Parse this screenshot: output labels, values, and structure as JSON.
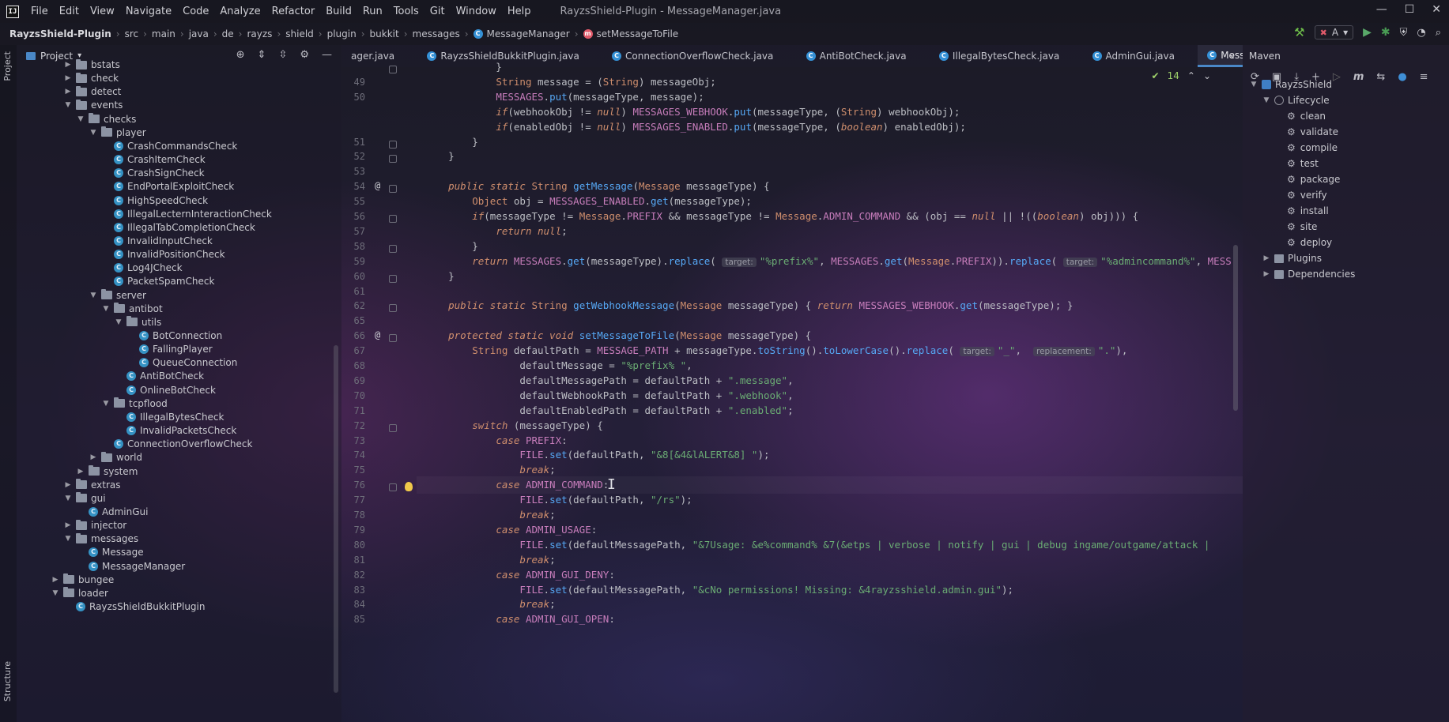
{
  "window": {
    "title": "RayzsShield-Plugin - MessageManager.java",
    "logo": "IJ"
  },
  "menu": [
    "File",
    "Edit",
    "View",
    "Navigate",
    "Code",
    "Analyze",
    "Refactor",
    "Build",
    "Run",
    "Tools",
    "Git",
    "Window",
    "Help"
  ],
  "breadcrumb": {
    "project": "RayzsShield-Plugin",
    "parts": [
      "src",
      "main",
      "java",
      "de",
      "rayzs",
      "shield",
      "plugin",
      "bukkit",
      "messages"
    ],
    "class": "MessageManager",
    "method": "setMessageToFile"
  },
  "toolbar": {
    "user": "A"
  },
  "left_stripe": {
    "project": "Project",
    "structure": "Structure"
  },
  "project_panel": {
    "title": "Project",
    "tree": [
      {
        "label": "bstats",
        "type": "folder",
        "depth": 4,
        "state": "collapsed"
      },
      {
        "label": "check",
        "type": "folder",
        "depth": 4,
        "state": "collapsed"
      },
      {
        "label": "detect",
        "type": "folder",
        "depth": 4,
        "state": "collapsed"
      },
      {
        "label": "events",
        "type": "folder",
        "depth": 4,
        "state": "expanded"
      },
      {
        "label": "checks",
        "type": "folder",
        "depth": 5,
        "state": "expanded"
      },
      {
        "label": "player",
        "type": "folder",
        "depth": 6,
        "state": "expanded"
      },
      {
        "label": "CrashCommandsCheck",
        "type": "class",
        "depth": 7
      },
      {
        "label": "CrashItemCheck",
        "type": "class",
        "depth": 7
      },
      {
        "label": "CrashSignCheck",
        "type": "class",
        "depth": 7
      },
      {
        "label": "EndPortalExploitCheck",
        "type": "class",
        "depth": 7
      },
      {
        "label": "HighSpeedCheck",
        "type": "class",
        "depth": 7
      },
      {
        "label": "IllegalLecternInteractionCheck",
        "type": "class",
        "depth": 7
      },
      {
        "label": "IllegalTabCompletionCheck",
        "type": "class",
        "depth": 7
      },
      {
        "label": "InvalidInputCheck",
        "type": "class",
        "depth": 7
      },
      {
        "label": "InvalidPositionCheck",
        "type": "class",
        "depth": 7
      },
      {
        "label": "Log4JCheck",
        "type": "class",
        "depth": 7
      },
      {
        "label": "PacketSpamCheck",
        "type": "class",
        "depth": 7
      },
      {
        "label": "server",
        "type": "folder",
        "depth": 6,
        "state": "expanded"
      },
      {
        "label": "antibot",
        "type": "folder",
        "depth": 7,
        "state": "expanded"
      },
      {
        "label": "utils",
        "type": "folder",
        "depth": 8,
        "state": "expanded"
      },
      {
        "label": "BotConnection",
        "type": "class",
        "depth": 9
      },
      {
        "label": "FallingPlayer",
        "type": "class",
        "depth": 9
      },
      {
        "label": "QueueConnection",
        "type": "class",
        "depth": 9
      },
      {
        "label": "AntiBotCheck",
        "type": "class",
        "depth": 8
      },
      {
        "label": "OnlineBotCheck",
        "type": "class",
        "depth": 8
      },
      {
        "label": "tcpflood",
        "type": "folder",
        "depth": 7,
        "state": "expanded"
      },
      {
        "label": "IllegalBytesCheck",
        "type": "class",
        "depth": 8
      },
      {
        "label": "InvalidPacketsCheck",
        "type": "class",
        "depth": 8
      },
      {
        "label": "ConnectionOverflowCheck",
        "type": "class",
        "depth": 7
      },
      {
        "label": "world",
        "type": "folder",
        "depth": 6,
        "state": "collapsed"
      },
      {
        "label": "system",
        "type": "folder",
        "depth": 5,
        "state": "collapsed"
      },
      {
        "label": "extras",
        "type": "folder",
        "depth": 4,
        "state": "collapsed"
      },
      {
        "label": "gui",
        "type": "folder",
        "depth": 4,
        "state": "expanded"
      },
      {
        "label": "AdminGui",
        "type": "class",
        "depth": 5
      },
      {
        "label": "injector",
        "type": "folder",
        "depth": 4,
        "state": "collapsed"
      },
      {
        "label": "messages",
        "type": "folder",
        "depth": 4,
        "state": "expanded"
      },
      {
        "label": "Message",
        "type": "class",
        "depth": 5
      },
      {
        "label": "MessageManager",
        "type": "class",
        "depth": 5
      },
      {
        "label": "bungee",
        "type": "folder",
        "depth": 3,
        "state": "collapsed"
      },
      {
        "label": "loader",
        "type": "folder",
        "depth": 3,
        "state": "expanded"
      },
      {
        "label": "RayzsShieldBukkitPlugin",
        "type": "class",
        "depth": 4
      }
    ]
  },
  "tabs": [
    {
      "label": "ager.java",
      "active": false
    },
    {
      "label": "RayzsShieldBukkitPlugin.java",
      "active": false
    },
    {
      "label": "ConnectionOverflowCheck.java",
      "active": false
    },
    {
      "label": "AntiBotCheck.java",
      "active": false
    },
    {
      "label": "IllegalBytesCheck.java",
      "active": false
    },
    {
      "label": "AdminGui.java",
      "active": false
    },
    {
      "label": "MessageManager.java",
      "active": true
    }
  ],
  "editor": {
    "inspection_count": "14",
    "lines": [
      {
        "n": "",
        "html": "            }"
      },
      {
        "n": "49",
        "html": "            <span class=\"kw\">String</span> message = (<span class=\"kw\">String</span>) messageObj;"
      },
      {
        "n": "50",
        "html": "            <span class=\"cn2\">MESSAGES</span>.<span class=\"fn\">put</span>(messageType, message);"
      },
      {
        "n": "",
        "html": "            <span class=\"it\">if</span>(webhookObj != <span class=\"it\">null</span>) <span class=\"cn2\">MESSAGES_WEBHOOK</span>.<span class=\"fn\">put</span>(messageType, (<span class=\"kw\">String</span>) webhookObj);"
      },
      {
        "n": "",
        "html": "            <span class=\"it\">if</span>(enabledObj != <span class=\"it\">null</span>) <span class=\"cn2\">MESSAGES_ENABLED</span>.<span class=\"fn\">put</span>(messageType, (<span class=\"it\">boolean</span>) enabledObj);"
      },
      {
        "n": "51",
        "html": "        }"
      },
      {
        "n": "52",
        "html": "    }"
      },
      {
        "n": "53",
        "html": ""
      },
      {
        "n": "54",
        "html": "    <span class=\"it\">public static</span> <span class=\"kw\">String</span> <span class=\"fn\">getMessage</span>(<span class=\"kw\">Message</span> messageType) {"
      },
      {
        "n": "55",
        "html": "        <span class=\"kw\">Object</span> obj = <span class=\"cn2\">MESSAGES_ENABLED</span>.<span class=\"fn\">get</span>(messageType);"
      },
      {
        "n": "56",
        "html": "        <span class=\"it\">if</span>(messageType != <span class=\"kw\">Message</span>.<span class=\"cn2\">PREFIX</span> &amp;&amp; messageType != <span class=\"kw\">Message</span>.<span class=\"cn2\">ADMIN_COMMAND</span> &amp;&amp; (obj == <span class=\"it\">null</span> || !((<span class=\"it\">boolean</span>) obj))) {"
      },
      {
        "n": "57",
        "html": "            <span class=\"it\">return null</span>;"
      },
      {
        "n": "58",
        "html": "        }"
      },
      {
        "n": "59",
        "html": "        <span class=\"it\">return</span> <span class=\"cn2\">MESSAGES</span>.<span class=\"fn\">get</span>(messageType).<span class=\"fn\">replace</span>( <span class=\"hint\">target:</span><span class=\"st\">\"%prefix%\"</span>, <span class=\"cn2\">MESSAGES</span>.<span class=\"fn\">get</span>(<span class=\"kw\">Message</span>.<span class=\"cn2\">PREFIX</span>)).<span class=\"fn\">replace</span>( <span class=\"hint\">target:</span><span class=\"st\">\"%admincommand%\"</span>, <span class=\"cn2\">MESS</span>"
      },
      {
        "n": "60",
        "html": "    }"
      },
      {
        "n": "61",
        "html": ""
      },
      {
        "n": "62",
        "html": "    <span class=\"it\">public static</span> <span class=\"kw\">String</span> <span class=\"fn\">getWebhookMessage</span>(<span class=\"kw\">Message</span> messageType) { <span class=\"it\">return</span> <span class=\"cn2\">MESSAGES_WEBHOOK</span>.<span class=\"fn\">get</span>(messageType); }"
      },
      {
        "n": "65",
        "html": ""
      },
      {
        "n": "66",
        "html": "    <span class=\"it\">protected static void</span> <span class=\"fn\">setMessageToFile</span>(<span class=\"kw\">Message</span> messageType) {"
      },
      {
        "n": "67",
        "html": "        <span class=\"kw\">String</span> defaultPath = <span class=\"cn2\">MESSAGE_PATH</span> + messageType.<span class=\"fn\">toString</span>().<span class=\"fn\">toLowerCase</span>().<span class=\"fn\">replace</span>( <span class=\"hint\">target:</span><span class=\"st\">\"_\"</span>,  <span class=\"hint\">replacement:</span><span class=\"st\">\".\"</span>),"
      },
      {
        "n": "68",
        "html": "                defaultMessage = <span class=\"st\">\"%prefix% \"</span>,"
      },
      {
        "n": "69",
        "html": "                defaultMessagePath = defaultPath + <span class=\"st\">\".message\"</span>,"
      },
      {
        "n": "70",
        "html": "                defaultWebhookPath = defaultPath + <span class=\"st\">\".webhook\"</span>,"
      },
      {
        "n": "71",
        "html": "                defaultEnabledPath = defaultPath + <span class=\"st\">\".enabled\"</span>;"
      },
      {
        "n": "72",
        "html": "        <span class=\"it\">switch</span> (messageType) {"
      },
      {
        "n": "73",
        "html": "            <span class=\"it\">case</span> <span class=\"cn2\">PREFIX</span>:"
      },
      {
        "n": "74",
        "html": "                <span class=\"cn2\">FILE</span>.<span class=\"fn\">set</span>(defaultPath, <span class=\"st\">\"&amp;8[&amp;4&amp;lALERT&amp;8] \"</span>);"
      },
      {
        "n": "75",
        "html": "                <span class=\"it\">break</span>;"
      },
      {
        "n": "76",
        "html": "            <span class=\"it\">case</span> <span class=\"cn2\">ADMIN_COMMAND</span>:"
      },
      {
        "n": "77",
        "html": "                <span class=\"cn2\">FILE</span>.<span class=\"fn\">set</span>(defaultPath, <span class=\"st\">\"/rs\"</span>);"
      },
      {
        "n": "78",
        "html": "                <span class=\"it\">break</span>;"
      },
      {
        "n": "79",
        "html": "            <span class=\"it\">case</span> <span class=\"cn2\">ADMIN_USAGE</span>:"
      },
      {
        "n": "80",
        "html": "                <span class=\"cn2\">FILE</span>.<span class=\"fn\">set</span>(defaultMessagePath, <span class=\"st\">\"&amp;7Usage: &amp;e%command% &amp;7(&amp;etps | verbose | notify | gui | debug ingame/outgame/attack |</span>"
      },
      {
        "n": "81",
        "html": "                <span class=\"it\">break</span>;"
      },
      {
        "n": "82",
        "html": "            <span class=\"it\">case</span> <span class=\"cn2\">ADMIN_GUI_DENY</span>:"
      },
      {
        "n": "83",
        "html": "                <span class=\"cn2\">FILE</span>.<span class=\"fn\">set</span>(defaultMessagePath, <span class=\"st\">\"&amp;cNo permissions! Missing: &amp;4rayzsshield.admin.gui\"</span>);"
      },
      {
        "n": "84",
        "html": "                <span class=\"it\">break</span>;"
      },
      {
        "n": "85",
        "html": "            <span class=\"it\">case</span> <span class=\"cn2\">ADMIN_GUI_OPEN</span>:"
      }
    ]
  },
  "maven": {
    "title": "Maven",
    "tree": [
      {
        "label": "RayzsShield",
        "type": "module",
        "depth": 0,
        "state": "expanded"
      },
      {
        "label": "Lifecycle",
        "type": "lifecycle",
        "depth": 1,
        "state": "expanded"
      },
      {
        "label": "clean",
        "type": "goal",
        "depth": 2
      },
      {
        "label": "validate",
        "type": "goal",
        "depth": 2
      },
      {
        "label": "compile",
        "type": "goal",
        "depth": 2
      },
      {
        "label": "test",
        "type": "goal",
        "depth": 2
      },
      {
        "label": "package",
        "type": "goal",
        "depth": 2
      },
      {
        "label": "verify",
        "type": "goal",
        "depth": 2
      },
      {
        "label": "install",
        "type": "goal",
        "depth": 2
      },
      {
        "label": "site",
        "type": "goal",
        "depth": 2
      },
      {
        "label": "deploy",
        "type": "goal",
        "depth": 2
      },
      {
        "label": "Plugins",
        "type": "folder",
        "depth": 1,
        "state": "collapsed"
      },
      {
        "label": "Dependencies",
        "type": "folder",
        "depth": 1,
        "state": "collapsed"
      }
    ]
  }
}
